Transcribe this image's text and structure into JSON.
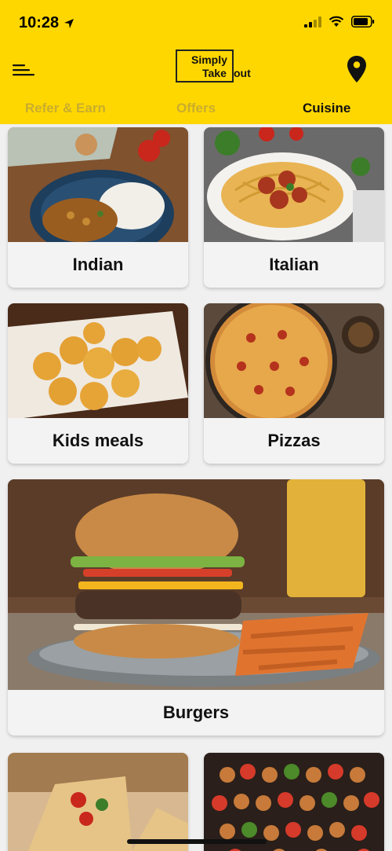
{
  "status": {
    "time": "10:28"
  },
  "logo": {
    "line1": "Simply",
    "line2": "Take",
    "line3": "out"
  },
  "tabs": [
    {
      "label": "Refer & Earn"
    },
    {
      "label": "Offers"
    },
    {
      "label": "Cuisine"
    }
  ],
  "active_tab": "Cuisine",
  "cuisines": [
    {
      "label": "Indian"
    },
    {
      "label": "Italian"
    },
    {
      "label": "Kids meals"
    },
    {
      "label": "Pizzas"
    },
    {
      "label": "Burgers"
    }
  ],
  "colors": {
    "header": "#ffd700",
    "inactive_tab": "#c9ad2e",
    "active_tab": "#111111"
  },
  "icons": {
    "menu": "menu-icon",
    "location": "location-pin-icon"
  }
}
